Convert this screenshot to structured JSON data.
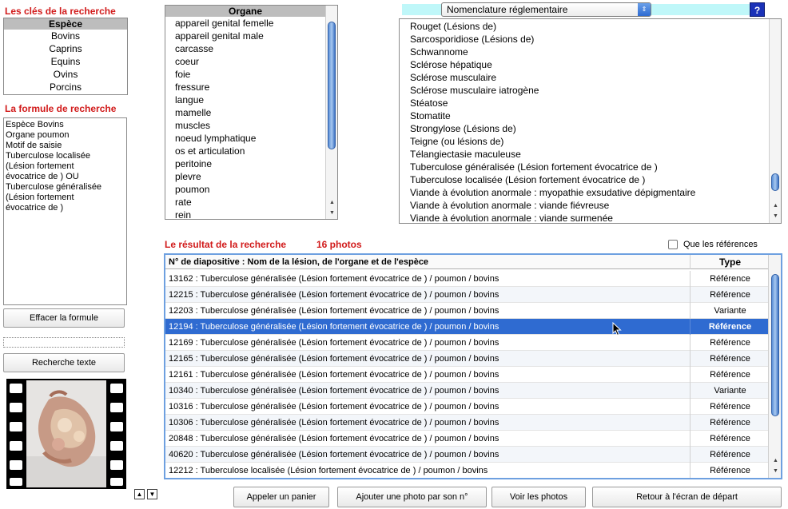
{
  "keys_title": "Les clés de la recherche",
  "species": {
    "header": "Espèce",
    "items": [
      "Bovins",
      "Caprins",
      "Equins",
      "Ovins",
      "Porcins"
    ]
  },
  "formula_title": "La formule de recherche",
  "formula_text": "Espèce Bovins\nOrgane poumon\nMotif de saisie\nTuberculose localisée\n(Lésion fortement\névocatrice de ) OU\nTuberculose généralisée\n(Lésion fortement\névocatrice de )",
  "buttons": {
    "clear_formula": "Effacer la formule",
    "text_search": "Recherche texte",
    "call_basket": "Appeler un panier",
    "add_photo": "Ajouter une photo par son n°",
    "view_photos": "Voir les photos",
    "back_home": "Retour à l'écran de départ"
  },
  "organ": {
    "header": "Organe",
    "items": [
      "appareil genital femelle",
      "appareil genital male",
      "carcasse",
      "coeur",
      "foie",
      "fressure",
      "langue",
      "mamelle",
      "muscles",
      "noeud lymphatique",
      "os et articulation",
      "peritoine",
      "plevre",
      "poumon",
      "rate",
      "rein"
    ]
  },
  "nomenclature": {
    "selected": "Nomenclature réglementaire",
    "help": "?",
    "items": [
      "Rouget (Lésions de)",
      "Sarcosporidiose (Lésions de)",
      "Schwannome",
      "Sclérose hépatique",
      "Sclérose musculaire",
      "Sclérose musculaire iatrogène",
      "Stéatose",
      "Stomatite",
      "Strongylose (Lésions de)",
      "Teigne (ou lésions de)",
      "Télangiectasie maculeuse",
      "Tuberculose généralisée (Lésion fortement évocatrice de )",
      "Tuberculose localisée (Lésion fortement évocatrice de )",
      "Viande à évolution anormale : myopathie exsudative dépigmentaire",
      "Viande à évolution anormale : viande fiévreuse",
      "Viande à évolution anormale : viande surmenée"
    ]
  },
  "result": {
    "title": "Le résultat de la recherche",
    "count": "16 photos",
    "only_refs": "Que les références",
    "col_main": "N° de diapositive : Nom de la lésion, de l'organe et de l'espèce",
    "col_type": "Type",
    "rows": [
      {
        "text": "13162 :  Tuberculose généralisée (Lésion fortement évocatrice de ) / poumon / bovins",
        "type": "Référence"
      },
      {
        "text": "12215 :  Tuberculose généralisée (Lésion fortement évocatrice de ) / poumon / bovins",
        "type": "Référence"
      },
      {
        "text": "12203 :  Tuberculose généralisée (Lésion fortement évocatrice de ) / poumon / bovins",
        "type": "Variante"
      },
      {
        "text": "12194 :  Tuberculose généralisée (Lésion fortement évocatrice de ) / poumon / bovins",
        "type": "Référence"
      },
      {
        "text": "12169 :  Tuberculose généralisée (Lésion fortement évocatrice de ) / poumon / bovins",
        "type": "Référence"
      },
      {
        "text": "12165 :  Tuberculose généralisée (Lésion fortement évocatrice de ) / poumon / bovins",
        "type": "Référence"
      },
      {
        "text": "12161 :  Tuberculose généralisée (Lésion fortement évocatrice de ) / poumon / bovins",
        "type": "Référence"
      },
      {
        "text": "10340 :  Tuberculose généralisée (Lésion fortement évocatrice de ) / poumon / bovins",
        "type": "Variante"
      },
      {
        "text": "10316 :  Tuberculose généralisée (Lésion fortement évocatrice de ) / poumon / bovins",
        "type": "Référence"
      },
      {
        "text": "10306 :  Tuberculose généralisée (Lésion fortement évocatrice de ) / poumon / bovins",
        "type": "Référence"
      },
      {
        "text": "20848 :  Tuberculose généralisée (Lésion fortement évocatrice de ) / poumon / bovins",
        "type": "Référence"
      },
      {
        "text": "40620 :  Tuberculose généralisée (Lésion fortement évocatrice de ) / poumon / bovins",
        "type": "Référence"
      },
      {
        "text": "12212 :  Tuberculose localisée (Lésion fortement évocatrice de ) / poumon / bovins",
        "type": "Référence"
      }
    ]
  }
}
